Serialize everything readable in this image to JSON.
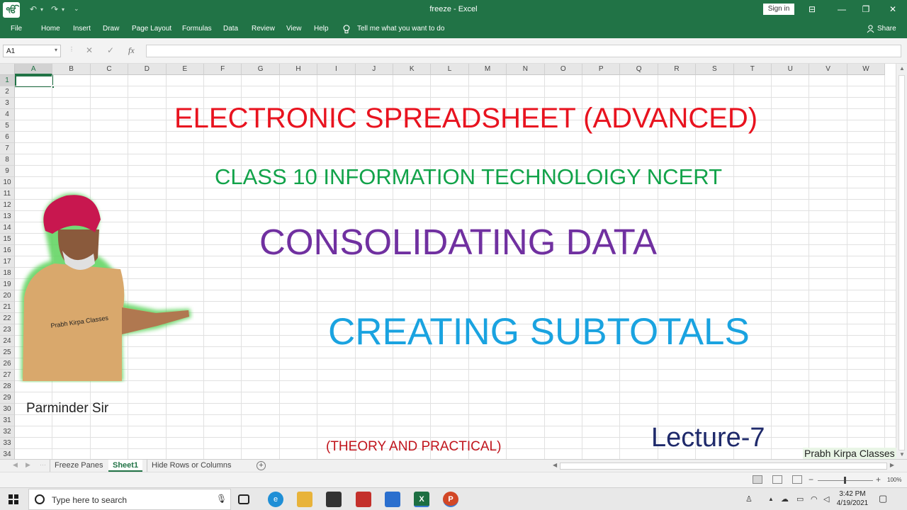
{
  "window": {
    "app_icon_glyph": "ੴ",
    "title": "freeze  -  Excel",
    "sign_in": "Sign in",
    "ribbon_display_glyph": "⊟",
    "minimize_glyph": "—",
    "restore_glyph": "❐",
    "close_glyph": "✕",
    "undo_glyph": "↶",
    "redo_glyph": "↷",
    "customize_glyph": "⌄"
  },
  "ribbon": {
    "tabs": [
      "File",
      "Home",
      "Insert",
      "Draw",
      "Page Layout",
      "Formulas",
      "Data",
      "Review",
      "View",
      "Help"
    ],
    "tell_me": "Tell me what you want to do",
    "share": "Share"
  },
  "formula_bar": {
    "name_box": "A1",
    "cancel_glyph": "✕",
    "enter_glyph": "✓",
    "fx": "fx",
    "content": ""
  },
  "sheet": {
    "columns": [
      "A",
      "B",
      "C",
      "D",
      "E",
      "F",
      "G",
      "H",
      "I",
      "J",
      "K",
      "L",
      "M",
      "N",
      "O",
      "P",
      "Q",
      "R",
      "S",
      "T",
      "U",
      "V",
      "W"
    ],
    "rows": [
      "1",
      "2",
      "3",
      "4",
      "5",
      "6",
      "7",
      "8",
      "9",
      "10",
      "11",
      "12",
      "13",
      "14",
      "15",
      "16",
      "17",
      "18",
      "19",
      "20",
      "21",
      "22",
      "23",
      "24",
      "25",
      "26",
      "27",
      "28",
      "29",
      "30",
      "31",
      "32",
      "33",
      "34"
    ],
    "selected_cell": "A1"
  },
  "overlay": {
    "heading": "ELECTRONIC SPREADSHEET (ADVANCED)",
    "subheading": "CLASS 10 INFORMATION TECHNOLOIGY NCERT",
    "topic1": "CONSOLIDATING DATA",
    "topic2": "CREATING SUBTOTALS",
    "theory": "(THEORY AND PRACTICAL)",
    "lecture": "Lecture-7",
    "channel": "Prabh Kirpa Classes",
    "presenter": "Parminder Sir",
    "shirt_text": "Prabh Kirpa Classes"
  },
  "sheet_tabs": {
    "tabs": [
      "Freeze Panes",
      "Sheet1",
      "Hide Rows or Columns"
    ],
    "active": "Sheet1",
    "add_glyph": "+"
  },
  "status": {
    "zoom": "100%"
  },
  "taskbar": {
    "search_placeholder": "Type here to search",
    "time": "3:42 PM",
    "date": "4/19/2021",
    "excel_glyph": "X",
    "ppt_glyph": "P"
  },
  "colors": {
    "excel_green": "#217346",
    "heading": "#e8131f",
    "subheading": "#12a34a",
    "topic1": "#7030a0",
    "topic2": "#1aa3e0",
    "lecture": "#1f2a6b"
  }
}
